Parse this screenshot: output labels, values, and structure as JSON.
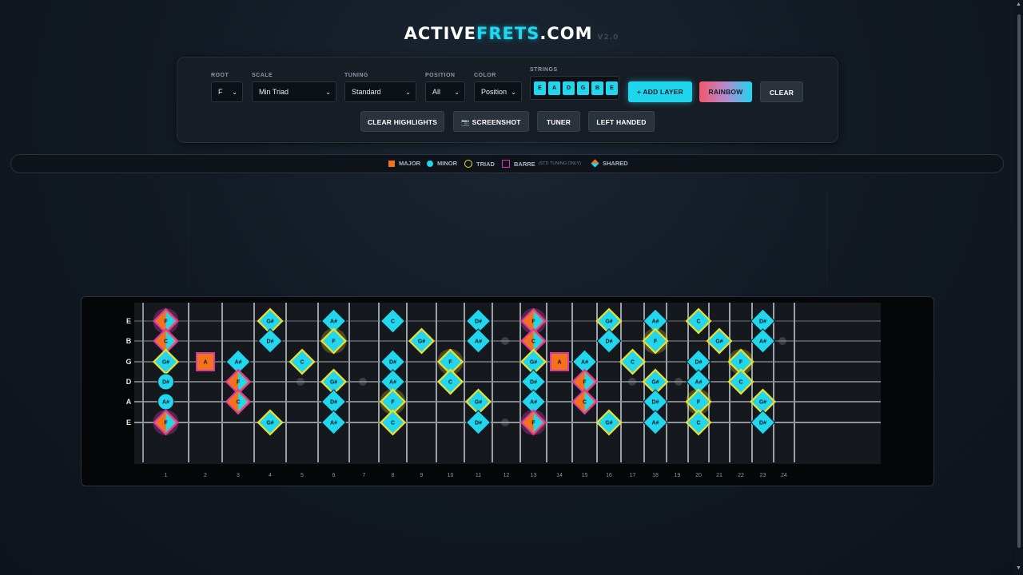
{
  "title": {
    "prefix": "ACTIVE",
    "accent": "FRETS",
    "suffix": ".COM",
    "version": "V2.0"
  },
  "controls": {
    "root": {
      "label": "ROOT",
      "value": "F"
    },
    "scale": {
      "label": "SCALE",
      "value": "Min Triad"
    },
    "tuning": {
      "label": "TUNING",
      "value": "Standard"
    },
    "position": {
      "label": "POSITION",
      "value": "All"
    },
    "color": {
      "label": "COLOR",
      "value": "Position"
    },
    "strings": {
      "label": "STRINGS",
      "items": [
        "E",
        "A",
        "D",
        "G",
        "B",
        "E"
      ]
    }
  },
  "buttons": {
    "add_layer": "+ ADD LAYER",
    "rainbow": "RAINBOW",
    "clear": "CLEAR",
    "clear_highlights": "CLEAR HIGHLIGHTS",
    "screenshot": "📷 SCREENSHOT",
    "tuner": "TUNER",
    "left_handed": "LEFT HANDED"
  },
  "legend": {
    "major": "MAJOR",
    "minor": "MINOR",
    "triad": "TRIAD",
    "barre": "BARRE",
    "barre_note": "(STD TUNING ONLY)",
    "shared": "SHARED"
  },
  "colors": {
    "accent": "#20d8f0",
    "major": "#f2731c",
    "minor": "#22d6ee",
    "triad": "#f0df2a",
    "barre": "#d63aa8"
  },
  "fretboard": {
    "string_labels": [
      "E",
      "B",
      "G",
      "D",
      "A",
      "E"
    ],
    "fret_numbers": [
      "1",
      "2",
      "3",
      "4",
      "5",
      "6",
      "7",
      "8",
      "9",
      "10",
      "11",
      "12",
      "13",
      "14",
      "15",
      "16",
      "17",
      "18",
      "19",
      "20",
      "21",
      "22",
      "23",
      "24"
    ],
    "markers": [
      {
        "s": 0,
        "f": 1,
        "n": "F",
        "k": "shared",
        "g": true
      },
      {
        "s": 0,
        "f": 4,
        "n": "G#",
        "k": "triad"
      },
      {
        "s": 0,
        "f": 6,
        "n": "A#",
        "k": "minor"
      },
      {
        "s": 0,
        "f": 8,
        "n": "C",
        "k": "minor"
      },
      {
        "s": 0,
        "f": 11,
        "n": "D#",
        "k": "minor"
      },
      {
        "s": 0,
        "f": 13,
        "n": "F",
        "k": "shared",
        "g": true
      },
      {
        "s": 0,
        "f": 16,
        "n": "G#",
        "k": "triad"
      },
      {
        "s": 0,
        "f": 18,
        "n": "A#",
        "k": "minor"
      },
      {
        "s": 0,
        "f": 20,
        "n": "C",
        "k": "triad"
      },
      {
        "s": 0,
        "f": 23,
        "n": "D#",
        "k": "minor"
      },
      {
        "s": 1,
        "f": 1,
        "n": "C",
        "k": "shared"
      },
      {
        "s": 1,
        "f": 4,
        "n": "D#",
        "k": "minor"
      },
      {
        "s": 1,
        "f": 6,
        "n": "F",
        "k": "triad",
        "g": true
      },
      {
        "s": 1,
        "f": 9,
        "n": "G#",
        "k": "triad"
      },
      {
        "s": 1,
        "f": 11,
        "n": "A#",
        "k": "minor"
      },
      {
        "s": 1,
        "f": 13,
        "n": "C",
        "k": "shared"
      },
      {
        "s": 1,
        "f": 16,
        "n": "D#",
        "k": "minor"
      },
      {
        "s": 1,
        "f": 18,
        "n": "F",
        "k": "triad",
        "g": true
      },
      {
        "s": 1,
        "f": 21,
        "n": "G#",
        "k": "triad"
      },
      {
        "s": 1,
        "f": 23,
        "n": "A#",
        "k": "minor"
      },
      {
        "s": 2,
        "f": 1,
        "n": "G#",
        "k": "triad"
      },
      {
        "s": 2,
        "f": 2,
        "n": "A",
        "k": "major"
      },
      {
        "s": 2,
        "f": 3,
        "n": "A#",
        "k": "minor"
      },
      {
        "s": 2,
        "f": 5,
        "n": "C",
        "k": "triad"
      },
      {
        "s": 2,
        "f": 8,
        "n": "D#",
        "k": "minor"
      },
      {
        "s": 2,
        "f": 10,
        "n": "F",
        "k": "triad",
        "g": true
      },
      {
        "s": 2,
        "f": 13,
        "n": "G#",
        "k": "triad"
      },
      {
        "s": 2,
        "f": 14,
        "n": "A",
        "k": "major"
      },
      {
        "s": 2,
        "f": 15,
        "n": "A#",
        "k": "minor"
      },
      {
        "s": 2,
        "f": 17,
        "n": "C",
        "k": "triad"
      },
      {
        "s": 2,
        "f": 20,
        "n": "D#",
        "k": "minor"
      },
      {
        "s": 2,
        "f": 22,
        "n": "F",
        "k": "triad",
        "g": true
      },
      {
        "s": 3,
        "f": 1,
        "n": "D#",
        "k": "circle"
      },
      {
        "s": 3,
        "f": 3,
        "n": "F",
        "k": "shared"
      },
      {
        "s": 3,
        "f": 6,
        "n": "G#",
        "k": "triad"
      },
      {
        "s": 3,
        "f": 8,
        "n": "A#",
        "k": "minor"
      },
      {
        "s": 3,
        "f": 10,
        "n": "C",
        "k": "triad"
      },
      {
        "s": 3,
        "f": 13,
        "n": "D#",
        "k": "minor"
      },
      {
        "s": 3,
        "f": 15,
        "n": "F",
        "k": "shared"
      },
      {
        "s": 3,
        "f": 18,
        "n": "G#",
        "k": "triad"
      },
      {
        "s": 3,
        "f": 20,
        "n": "A#",
        "k": "minor"
      },
      {
        "s": 3,
        "f": 22,
        "n": "C",
        "k": "triad"
      },
      {
        "s": 4,
        "f": 1,
        "n": "A#",
        "k": "circle"
      },
      {
        "s": 4,
        "f": 3,
        "n": "C",
        "k": "shared"
      },
      {
        "s": 4,
        "f": 6,
        "n": "D#",
        "k": "minor"
      },
      {
        "s": 4,
        "f": 8,
        "n": "F",
        "k": "triad",
        "g": true
      },
      {
        "s": 4,
        "f": 11,
        "n": "G#",
        "k": "triad"
      },
      {
        "s": 4,
        "f": 13,
        "n": "A#",
        "k": "minor"
      },
      {
        "s": 4,
        "f": 15,
        "n": "C",
        "k": "shared"
      },
      {
        "s": 4,
        "f": 18,
        "n": "D#",
        "k": "minor"
      },
      {
        "s": 4,
        "f": 20,
        "n": "F",
        "k": "triad",
        "g": true
      },
      {
        "s": 4,
        "f": 23,
        "n": "G#",
        "k": "triad"
      },
      {
        "s": 5,
        "f": 1,
        "n": "F",
        "k": "shared",
        "g": true
      },
      {
        "s": 5,
        "f": 4,
        "n": "G#",
        "k": "triad"
      },
      {
        "s": 5,
        "f": 6,
        "n": "A#",
        "k": "minor"
      },
      {
        "s": 5,
        "f": 8,
        "n": "C",
        "k": "triad"
      },
      {
        "s": 5,
        "f": 11,
        "n": "D#",
        "k": "minor"
      },
      {
        "s": 5,
        "f": 13,
        "n": "F",
        "k": "shared",
        "g": true
      },
      {
        "s": 5,
        "f": 16,
        "n": "G#",
        "k": "triad"
      },
      {
        "s": 5,
        "f": 18,
        "n": "A#",
        "k": "minor"
      },
      {
        "s": 5,
        "f": 20,
        "n": "C",
        "k": "triad"
      },
      {
        "s": 5,
        "f": 23,
        "n": "D#",
        "k": "minor"
      }
    ]
  }
}
